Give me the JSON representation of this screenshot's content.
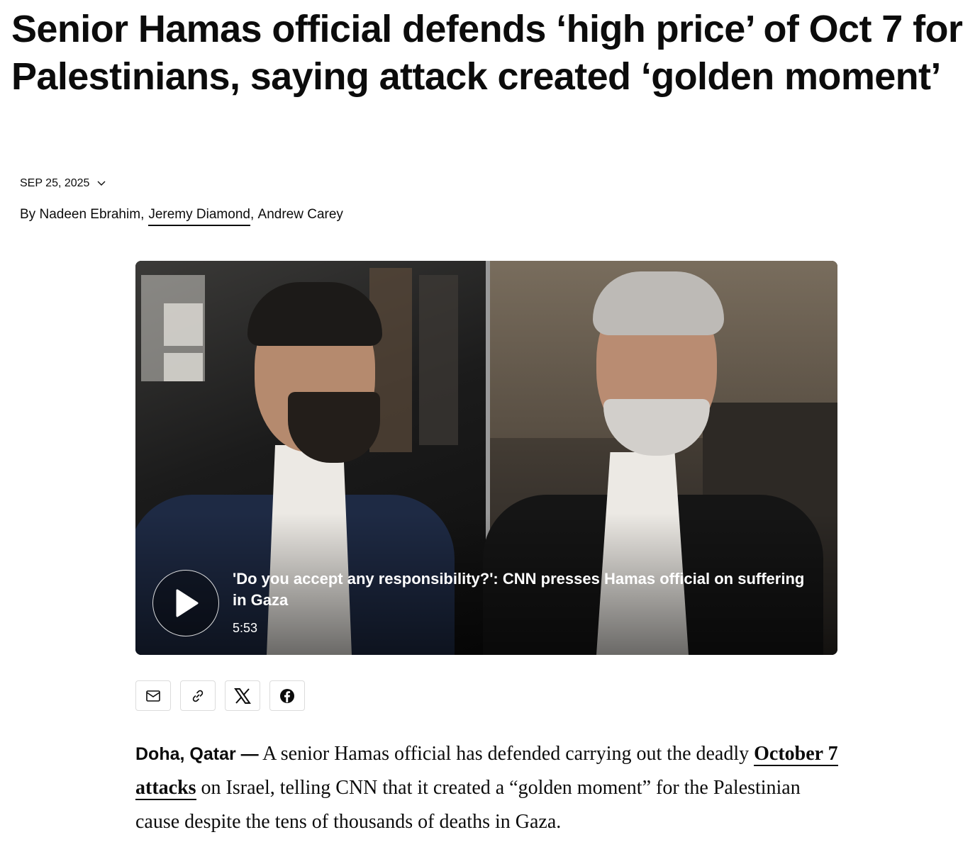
{
  "article": {
    "headline": "Senior Hamas official defends ‘high price’ of Oct 7 for Palestinians, saying attack created ‘golden moment’",
    "date": "SEP 25, 2025",
    "byline": {
      "prefix": "By",
      "authors": [
        {
          "name": "Nadeen Ebrahim",
          "linked": false
        },
        {
          "name": "Jeremy Diamond",
          "linked": true
        },
        {
          "name": "Andrew Carey",
          "linked": false
        }
      ]
    }
  },
  "video": {
    "title": "'Do you accept any responsibility?': CNN presses Hamas official on suffering in Gaza",
    "duration": "5:53",
    "play_icon": "play-icon"
  },
  "share": {
    "buttons": [
      {
        "icon": "email-icon"
      },
      {
        "icon": "link-icon"
      },
      {
        "icon": "x-icon"
      },
      {
        "icon": "facebook-icon"
      }
    ]
  },
  "body": {
    "dateline": "Doha, Qatar —",
    "p1_before": " A senior Hamas official has defended carrying out the deadly ",
    "p1_link": "October 7 attacks",
    "p1_after": " on Israel, telling CNN that it created a “golden moment” for the Palestinian cause despite the tens of thousands of deaths in Gaza."
  }
}
